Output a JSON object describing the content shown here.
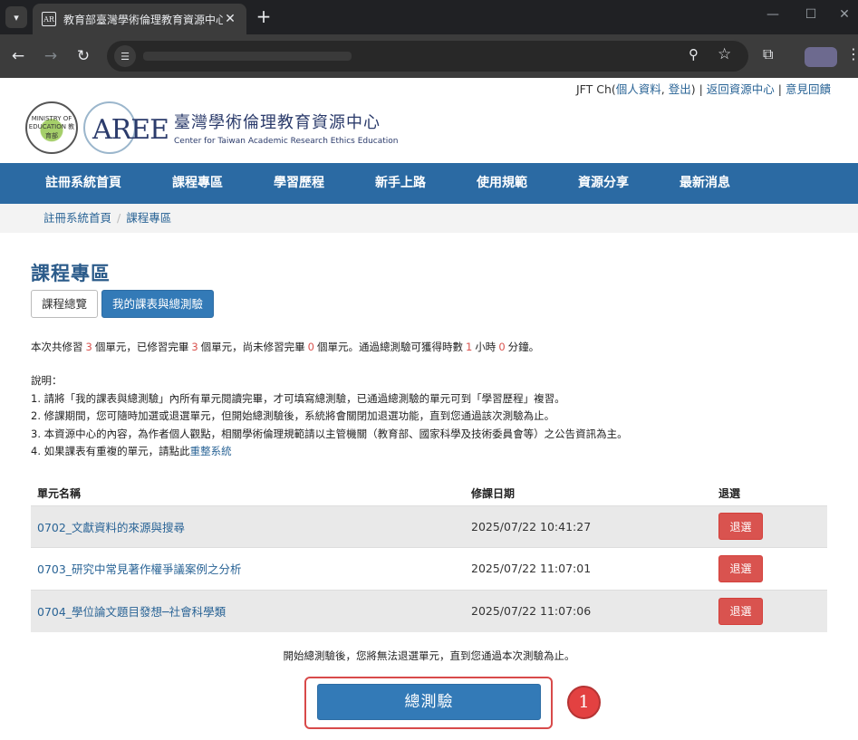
{
  "browser": {
    "tab_title": "教育部臺灣學術倫理教育資源中心",
    "favicon_text": "AR",
    "tab_menu_icon": "chevron-down-icon",
    "new_tab_glyph": "+",
    "minimize_glyph": "—",
    "maximize_glyph": "☐",
    "close_glyph": "✕",
    "tab_close_glyph": "✕",
    "back_glyph": "←",
    "forward_glyph": "→",
    "reload_glyph": "↻",
    "site_info_glyph": "☰",
    "zoom_glyph": "⚲",
    "star_glyph": "☆",
    "extensions_glyph": "⧉",
    "menu_glyph": "⋮"
  },
  "userbar": {
    "user": "JFT Ch(",
    "profile_link": "個人資料",
    "comma": ", ",
    "logout_link": "登出",
    "close_paren": ")",
    "sep": " | ",
    "back_link": "返回資源中心",
    "feedback_link": "意見回饋"
  },
  "logo": {
    "seal_text": "MINISTRY OF EDUCATION 教育部",
    "mark": "AREE",
    "zh": "臺灣學術倫理教育資源中心",
    "en": "Center for Taiwan Academic Research Ethics Education"
  },
  "nav": [
    {
      "label": "註冊系統首頁"
    },
    {
      "label": "課程專區"
    },
    {
      "label": "學習歷程"
    },
    {
      "label": "新手上路"
    },
    {
      "label": "使用規範"
    },
    {
      "label": "資源分享"
    },
    {
      "label": "最新消息"
    }
  ],
  "breadcrumb": {
    "home": "註冊系統首頁",
    "sep": "/",
    "current": "課程專區"
  },
  "page": {
    "title": "課程專區",
    "tab_overview": "課程總覽",
    "tab_mine": "我的課表與總測驗"
  },
  "summary": {
    "p1": "本次共修習",
    "n1": "3",
    "p2": "個單元，已修習完畢",
    "n2": "3",
    "p3": "個單元，尚未修習完畢",
    "n3": "0",
    "p4": "個單元。通過總測驗可獲得時數",
    "n4": "1",
    "p5": "小時",
    "n5": "0",
    "p6": "分鐘。"
  },
  "notes": {
    "heading": "說明：",
    "line1": "1. 請將「我的課表與總測驗」內所有單元閱讀完畢，才可填寫總測驗，已通過總測驗的單元可到「學習歷程」複習。",
    "line2": "2. 修課期間，您可隨時加選或退選單元，但開始總測驗後，系統將會關閉加退選功能，直到您通過該次測驗為止。",
    "line3": "3. 本資源中心的內容，為作者個人觀點，相關學術倫理規範請以主管機關（教育部、國家科學及技術委員會等）之公告資訊為主。",
    "line4_prefix": "4. 如果課表有重複的單元，請點此",
    "line4_link": "重整系統"
  },
  "table": {
    "headers": {
      "name": "單元名稱",
      "date": "修課日期",
      "drop": "退選"
    },
    "rows": [
      {
        "name": "0702_文獻資料的來源與搜尋",
        "date": "2025/07/22 10:41:27",
        "button": "退選"
      },
      {
        "name": "0703_研究中常見著作權爭議案例之分析",
        "date": "2025/07/22 11:07:01",
        "button": "退選"
      },
      {
        "name": "0704_學位論文題目發想─社會科學類",
        "date": "2025/07/22 11:07:06",
        "button": "退選"
      }
    ]
  },
  "warning": "開始總測驗後，您將無法退選單元，直到您通過本次測驗為止。",
  "exam_button": "總測驗",
  "step_badge": "1",
  "colors": {
    "nav_bg": "#2b6aa3",
    "primary": "#337ab7",
    "danger": "#d9534f",
    "highlight": "#d84a4a",
    "link": "#2a6496"
  }
}
